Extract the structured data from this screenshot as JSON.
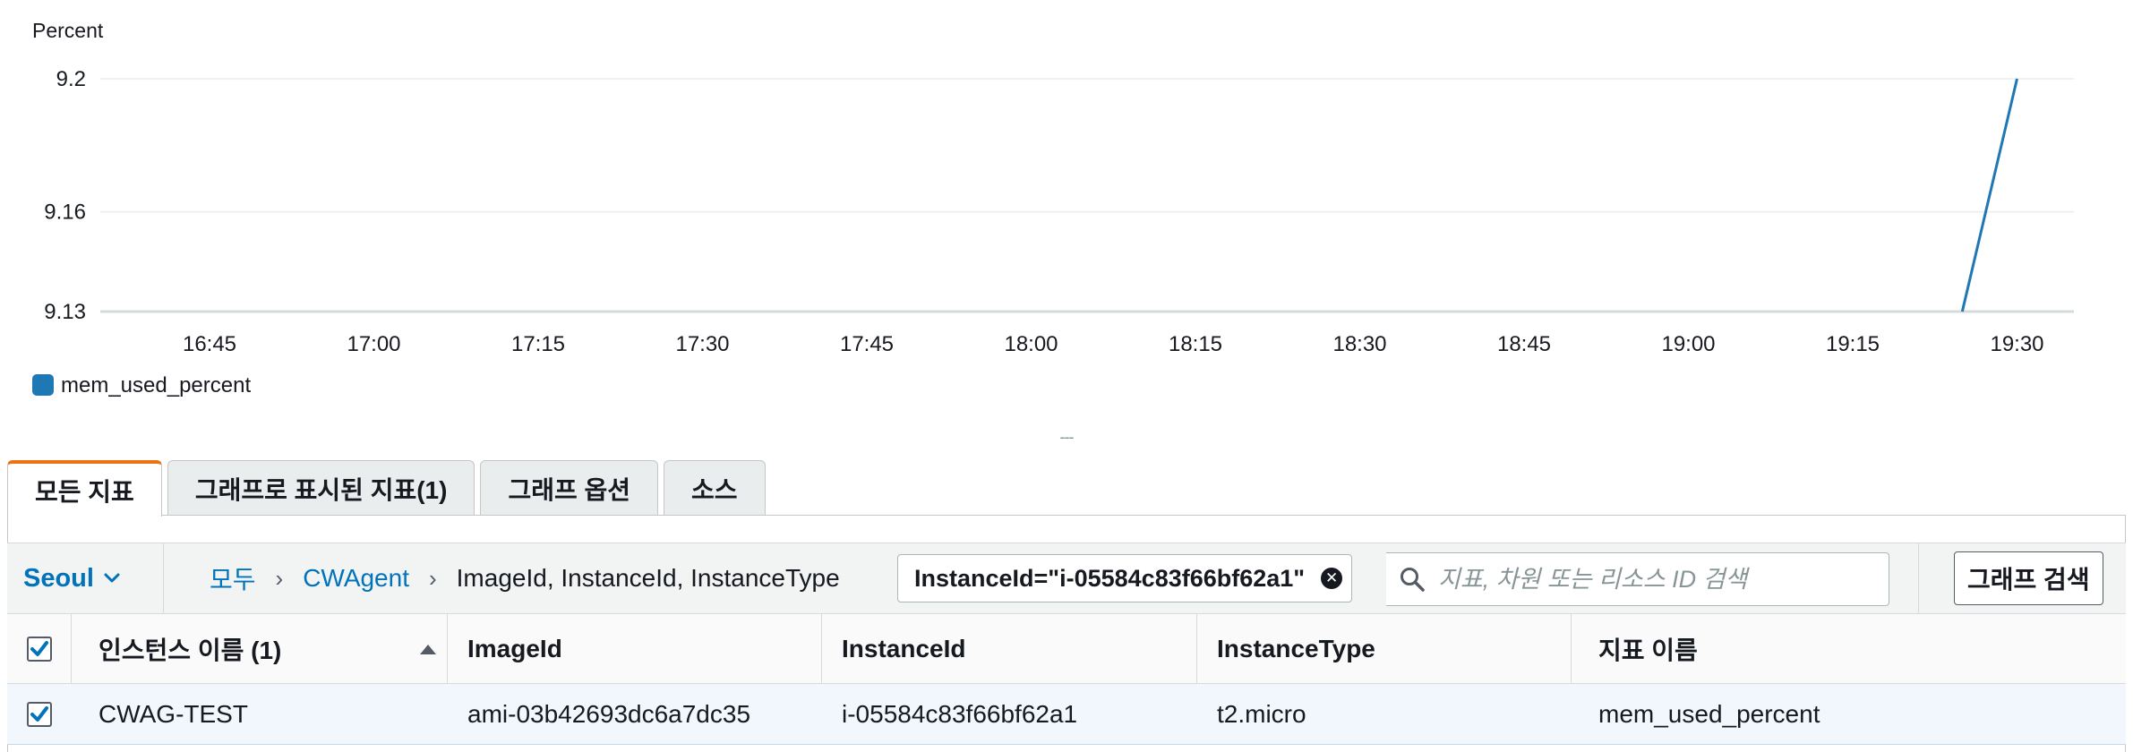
{
  "chart_data": {
    "type": "line",
    "title": "",
    "ylabel": "Percent",
    "xlabel": "",
    "ylim": [
      9.13,
      9.2
    ],
    "yticks": [
      9.13,
      9.16,
      9.2
    ],
    "xticks": [
      "16:45",
      "17:00",
      "17:15",
      "17:30",
      "17:45",
      "18:00",
      "18:15",
      "18:30",
      "18:45",
      "19:00",
      "19:15",
      "19:30"
    ],
    "grid": true,
    "legend_position": "bottom-left",
    "series": [
      {
        "name": "mem_used_percent",
        "color": "#1f77b4",
        "points": [
          {
            "x": "19:25",
            "y": 9.13
          },
          {
            "x": "19:30",
            "y": 9.2
          }
        ]
      }
    ]
  },
  "drag_handle": "---",
  "tabs": [
    {
      "label": "모든 지표",
      "active": true
    },
    {
      "label": "그래프로 표시된 지표(1)",
      "active": false
    },
    {
      "label": "그래프 옵션",
      "active": false
    },
    {
      "label": "소스",
      "active": false
    }
  ],
  "filter": {
    "region": "Seoul",
    "breadcrumb": {
      "all": "모두",
      "namespace": "CWAgent",
      "dimensions": "ImageId, InstanceId, InstanceType"
    },
    "token": "InstanceId=\"i-05584c83f66bf62a1\"",
    "search_placeholder": "지표, 차원 또는 리소스 ID 검색",
    "graph_search_label": "그래프 검색"
  },
  "table": {
    "columns": [
      "인스턴스 이름 (1)",
      "ImageId",
      "InstanceId",
      "InstanceType",
      "지표 이름"
    ],
    "rows": [
      {
        "checked": true,
        "instance_name": "CWAG-TEST",
        "image_id": "ami-03b42693dc6a7dc35",
        "instance_id": "i-05584c83f66bf62a1",
        "instance_type": "t2.micro",
        "metric_name": "mem_used_percent"
      }
    ]
  },
  "colors": {
    "link": "#0073bb",
    "tab_accent": "#ec7211",
    "selected_row": "#f1f7fc",
    "series": "#1f77b4"
  }
}
